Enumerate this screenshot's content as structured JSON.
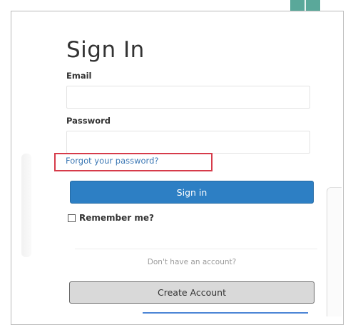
{
  "form": {
    "title": "Sign In",
    "email_label": "Email",
    "email_value": "",
    "password_label": "Password",
    "password_value": "",
    "forgot_link": "Forgot your password?",
    "signin_button": "Sign in",
    "remember_label": "Remember me?",
    "remember_checked": false,
    "no_account_text": "Don't have an account?",
    "create_button": "Create Account"
  },
  "colors": {
    "primary": "#2d7fc4",
    "link": "#3d79b5",
    "highlight": "#d63b4a",
    "secondary_button": "#d9d9d9",
    "accent": "#5aa89a"
  }
}
